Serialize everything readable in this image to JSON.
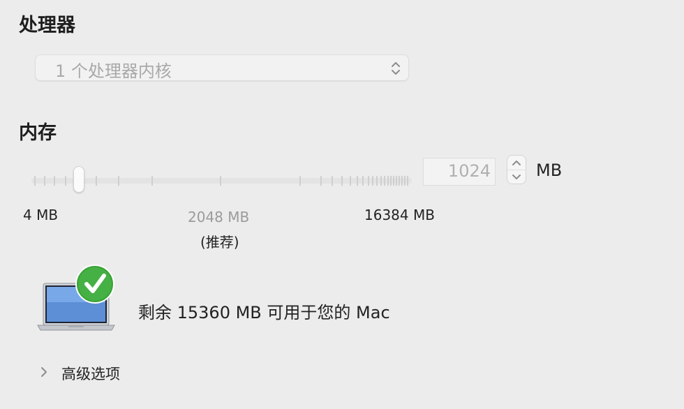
{
  "processor": {
    "title": "处理器",
    "popup_value": "1 个处理器内核"
  },
  "memory": {
    "title": "内存",
    "value": "1024",
    "unit": "MB",
    "slider_min_label": "4 MB",
    "slider_recommended_label": "2048 MB",
    "slider_recommended_note": "(推荐)",
    "slider_max_label": "16384 MB"
  },
  "availability": {
    "text": "剩余 15360 MB 可用于您的 Mac",
    "icon": "laptop-with-green-checkmark"
  },
  "advanced": {
    "label": "高级选项"
  },
  "colors": {
    "background": "#ececec",
    "check_green": "#3aa236"
  }
}
